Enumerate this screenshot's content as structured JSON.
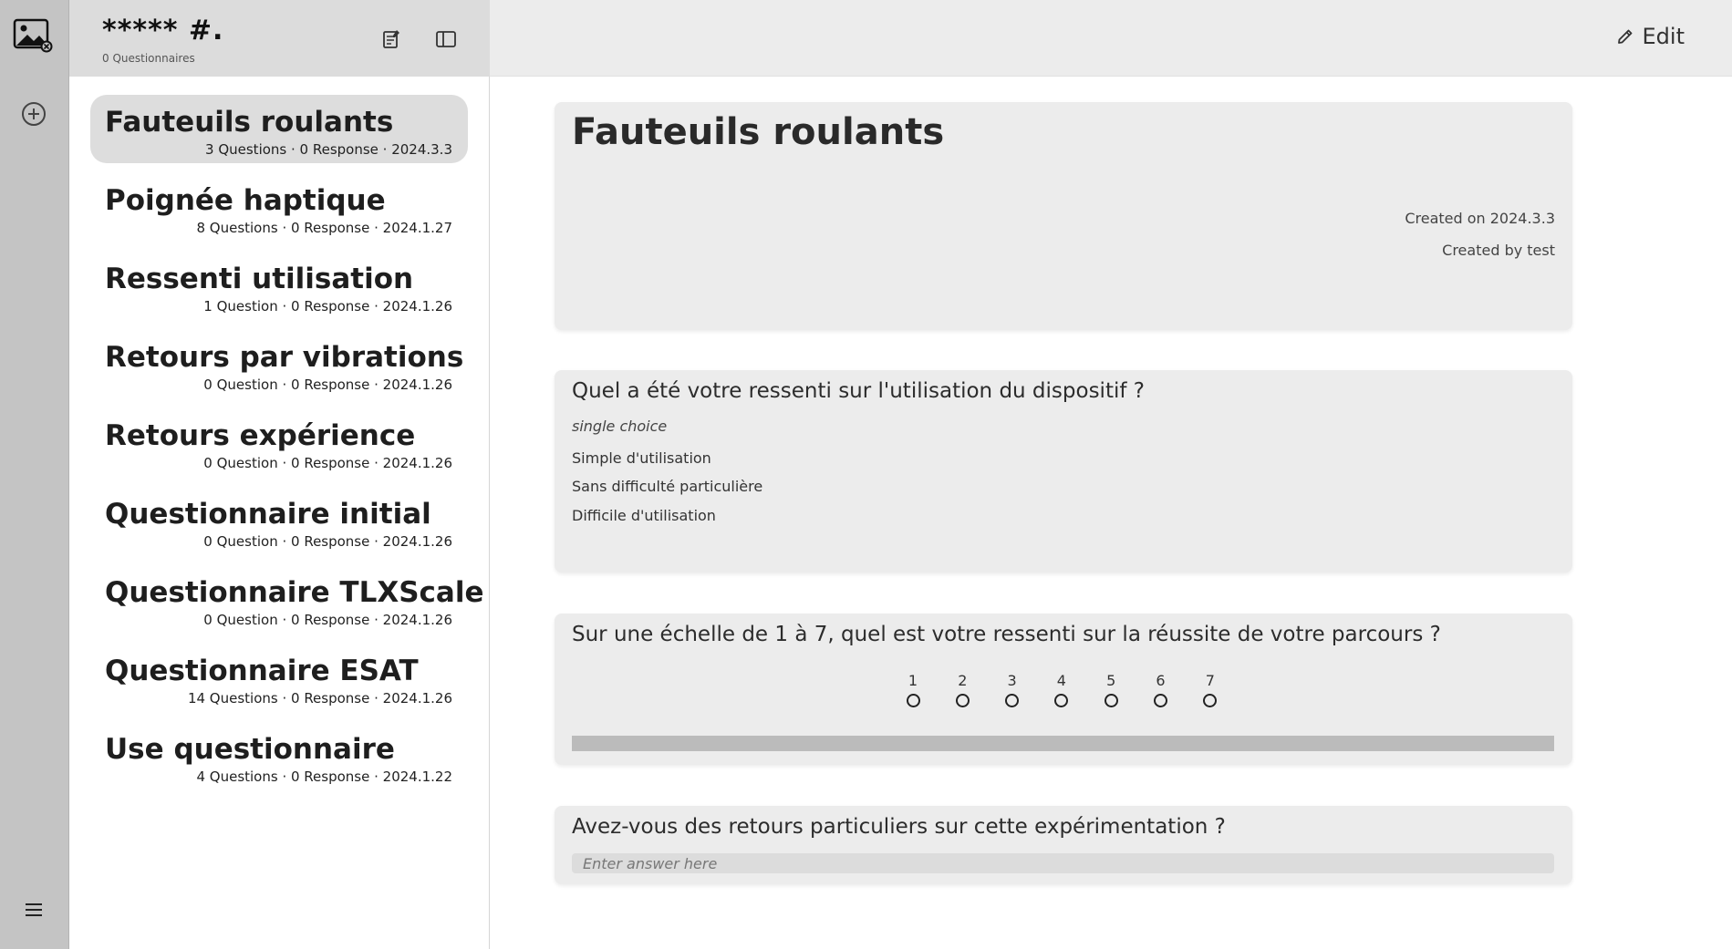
{
  "workspace": {
    "title": "***** #.",
    "count": "0 Questionnaires"
  },
  "icons": {
    "logo": "image-icon",
    "add": "plus-circle-icon",
    "menu": "hamburger-menu-icon",
    "new_questionnaire": "new-document-icon",
    "toggle_sidebar": "sidebar-toggle-icon",
    "edit": "pencil-icon"
  },
  "questionnaires": [
    {
      "name": "Fauteuils roulants",
      "meta": "3 Questions · 0 Response · 2024.3.3",
      "selected": true
    },
    {
      "name": "Poignée haptique",
      "meta": "8 Questions · 0 Response · 2024.1.27",
      "selected": false
    },
    {
      "name": "Ressenti utilisation",
      "meta": "1 Question · 0 Response · 2024.1.26",
      "selected": false
    },
    {
      "name": "Retours par vibrations",
      "meta": "0 Question · 0 Response · 2024.1.26",
      "selected": false
    },
    {
      "name": "Retours expérience",
      "meta": "0 Question · 0 Response · 2024.1.26",
      "selected": false
    },
    {
      "name": "Questionnaire initial",
      "meta": "0 Question · 0 Response · 2024.1.26",
      "selected": false
    },
    {
      "name": "Questionnaire TLXScale",
      "meta": "0 Question · 0 Response · 2024.1.26",
      "selected": false
    },
    {
      "name": "Questionnaire ESAT",
      "meta": "14 Questions · 0 Response · 2024.1.26",
      "selected": false
    },
    {
      "name": "Use questionnaire",
      "meta": "4 Questions · 0 Response · 2024.1.22",
      "selected": false
    }
  ],
  "topbar": {
    "edit_label": "Edit"
  },
  "detail": {
    "title": "Fauteuils roulants",
    "created_on": "Created on 2024.3.3",
    "created_by": "Created by test"
  },
  "questions": [
    {
      "text": "Quel a été votre ressenti sur l'utilisation du dispositif ?",
      "type": "single choice",
      "options": [
        "Simple d'utilisation",
        "Sans difficulté particulière",
        "Difficile d'utilisation"
      ]
    },
    {
      "text": "Sur une échelle de 1 à 7, quel est votre ressenti sur la réussite de votre parcours ?",
      "scale": [
        "1",
        "2",
        "3",
        "4",
        "5",
        "6",
        "7"
      ]
    },
    {
      "text": "Avez-vous des retours particuliers sur cette expérimentation ?",
      "placeholder": "Enter answer here"
    }
  ]
}
